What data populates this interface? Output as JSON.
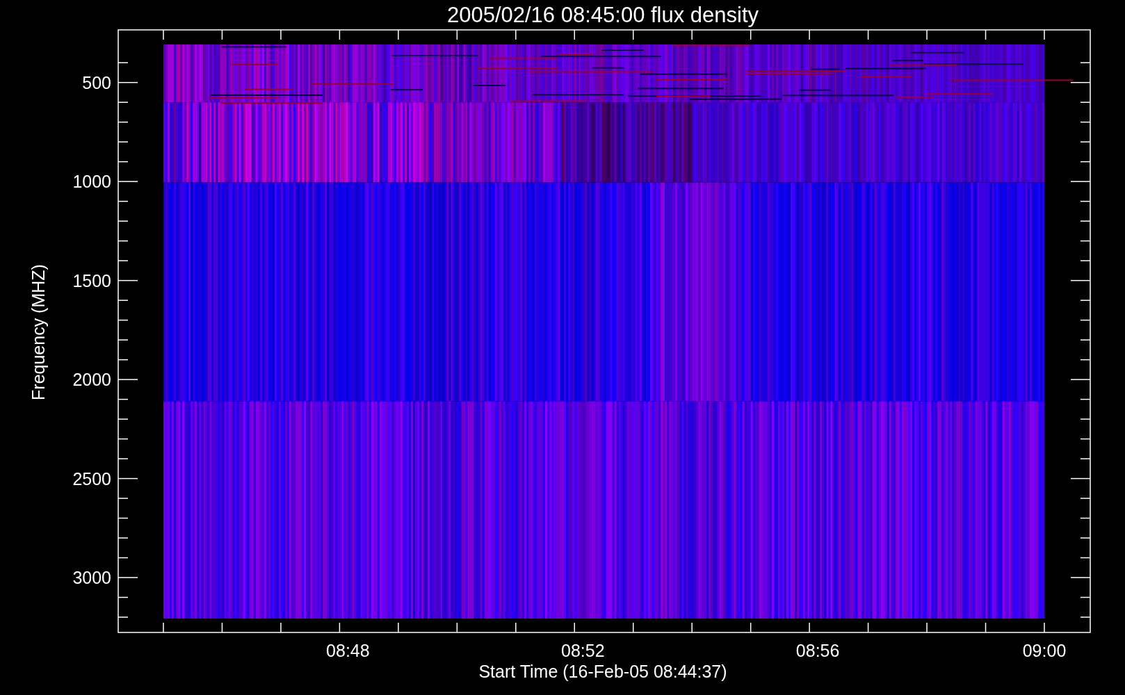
{
  "title": "2005/02/16 08:45:00 flux density",
  "y_axis": {
    "title": "Frequency (MHZ)",
    "tick_labels": [
      "500",
      "1000",
      "1500",
      "2000",
      "2500",
      "3000"
    ]
  },
  "x_axis": {
    "title": "Start Time (16-Feb-05 08:44:37)",
    "tick_labels": [
      "08:48",
      "08:52",
      "08:56",
      "09:00"
    ]
  }
}
